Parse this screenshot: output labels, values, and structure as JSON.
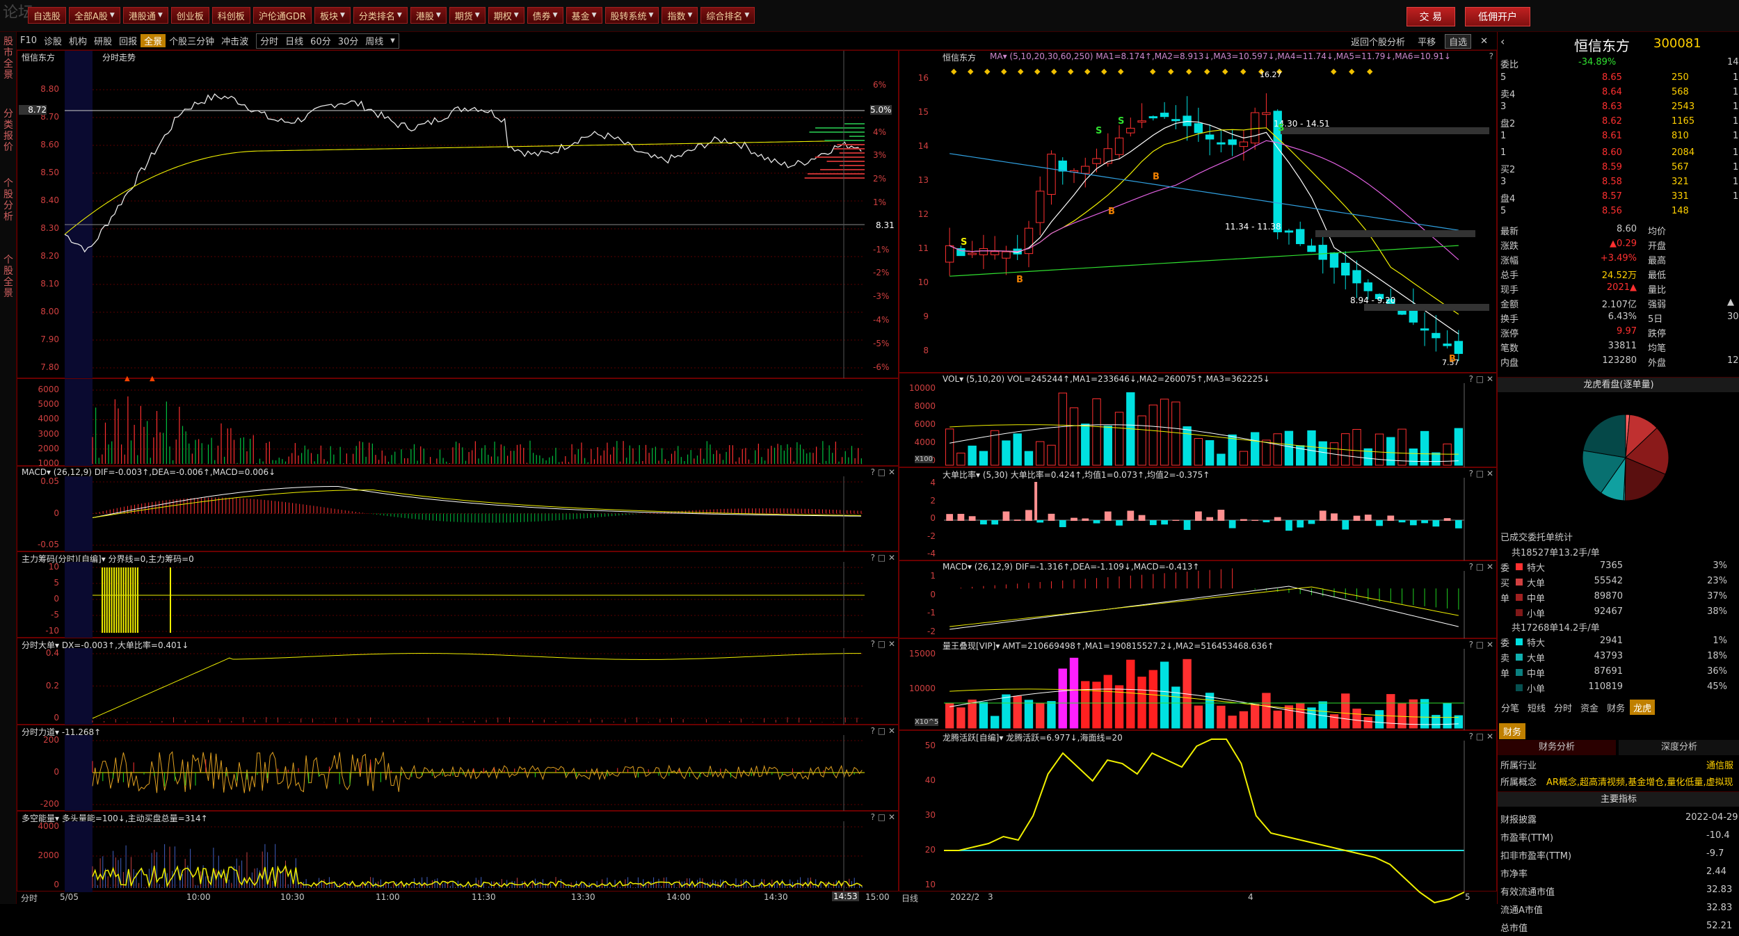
{
  "window": {
    "logo": "论坛",
    "title": "恒信东方"
  },
  "menu": [
    {
      "label": "自选股",
      "dd": false
    },
    {
      "label": "全部A股",
      "dd": true
    },
    {
      "label": "港股通",
      "dd": true
    },
    {
      "label": "创业板",
      "dd": false
    },
    {
      "label": "科创板",
      "dd": false
    },
    {
      "label": "沪伦通GDR",
      "dd": false
    },
    {
      "label": "板块",
      "dd": true
    },
    {
      "label": "分类排名",
      "dd": true
    },
    {
      "label": "港股",
      "dd": true
    },
    {
      "label": "期货",
      "dd": true
    },
    {
      "label": "期权",
      "dd": true
    },
    {
      "label": "债券",
      "dd": true
    },
    {
      "label": "基金",
      "dd": true
    },
    {
      "label": "股转系统",
      "dd": true
    },
    {
      "label": "指数",
      "dd": true
    },
    {
      "label": "综合排名",
      "dd": true
    }
  ],
  "trade": {
    "trade_label": "交 易",
    "open_account_label": "低佣开户"
  },
  "leftstrip": [
    {
      "label": "股市全景"
    },
    {
      "label": "分类报价"
    },
    {
      "label": "个股分析"
    },
    {
      "label": "个股全景"
    }
  ],
  "toolbar": {
    "left": [
      "F10",
      "诊股",
      "机构",
      "研股",
      "回报",
      "全景",
      "个股三分钟",
      "冲击波"
    ],
    "active": "全景",
    "periods": [
      "分时",
      "日线",
      "60分",
      "30分",
      "周线"
    ],
    "back": "返回个股分析",
    "flat": "平移",
    "watch": "自选"
  },
  "intraday": {
    "title": "恒信东方",
    "subtitle": "分时走势",
    "prices": [
      "8.80",
      "8.70",
      "8.60",
      "8.50",
      "8.40",
      "8.30",
      "8.20",
      "8.10",
      "8.00",
      "7.90",
      "7.80"
    ],
    "pcts": [
      "6%",
      "5%",
      "4%",
      "3%",
      "2%",
      "1%",
      "",
      "-1%",
      "-2%",
      "-3%",
      "-4%",
      "-5%",
      "-6%"
    ],
    "price_flag": "8.72",
    "pct_flag": "5.0%",
    "prev_close": "8.31",
    "vol_ticks": [
      "6000",
      "5000",
      "4000",
      "3000",
      "2000",
      "1000"
    ],
    "times": [
      "5/05",
      "10:00",
      "10:30",
      "11:00",
      "11:30",
      "13:30",
      "14:00",
      "14:30",
      "15:00"
    ],
    "last_time": "14:53",
    "axis_label": "分时"
  },
  "sub_left": [
    {
      "name": "MACD",
      "title": "MACD▾ (26,12,9)  DIF=-0.003↑,DEA=-0.006↑,MACD=0.006↓",
      "ticks": [
        "0.05",
        "0",
        "-0.05"
      ]
    },
    {
      "name": "zhuli",
      "title": "主力筹码(分时)[自编]▾ 分界线=0,主力筹码=0",
      "ticks": [
        "10",
        "5",
        "0",
        "-5",
        "-10"
      ]
    },
    {
      "name": "dadan",
      "title": "分时大单▾ DX=-0.003↑,大单比率=0.401↓",
      "ticks": [
        "0.4",
        "0.2",
        "0"
      ]
    },
    {
      "name": "lidao",
      "title": "分时力道▾ -11.268↑",
      "ticks": [
        "200",
        "0",
        "-200"
      ]
    },
    {
      "name": "duokong",
      "title": "多空能量▾ 多头量能=100↓,主动买盘总量=314↑",
      "ticks": [
        "4000",
        "2000",
        "0"
      ]
    }
  ],
  "kline": {
    "title": "恒信东方",
    "ma": "MA▾ (5,10,20,30,60,250)  MA1=8.174↑,MA2=8.913↓,MA3=10.597↓,MA4=11.74↓,MA5=11.79↓,MA6=10.91↓",
    "prices": [
      "16",
      "15",
      "14",
      "13",
      "12",
      "11",
      "10",
      "9",
      "8"
    ],
    "annot": [
      "14.30 - 14.51",
      "11.34 - 11.38",
      "8.94 - 9.20"
    ],
    "hi": "16.27",
    "lo": "7.57",
    "dates": [
      "2022/2",
      "3",
      "4",
      "5"
    ],
    "axis_label": "日线"
  },
  "sub_right": [
    {
      "name": "vol",
      "title": "VOL▾ (5,10,20)  VOL=245244↑,MA1=233646↓,MA2=260075↑,MA3=362225↓",
      "ticks": [
        "10000",
        "8000",
        "6000",
        "4000",
        "2000"
      ],
      "unit": "X100"
    },
    {
      "name": "ddbl",
      "title": "大单比率▾ (5,30)  大单比率=0.424↑,均值1=0.073↑,均值2=-0.375↑",
      "ticks": [
        "4",
        "2",
        "0",
        "-2",
        "-4"
      ]
    },
    {
      "name": "macd2",
      "title": "MACD▾ (26,12,9)  DIF=-1.316↑,DEA=-1.109↓,MACD=-0.413↑",
      "ticks": [
        "1",
        "0",
        "-1",
        "-2"
      ]
    },
    {
      "name": "lwdx",
      "title": "量王叠现[VIP]▾ AMT=210669498↑,MA1=190815527.2↓,MA2=516453468.636↑",
      "ticks": [
        "15000",
        "10000",
        "5000"
      ],
      "unit": "X10^5"
    },
    {
      "name": "lthy",
      "title": "龙腾活跃[自编]▾ 龙腾活跃=6.977↓,海面线=20",
      "ticks": [
        "50",
        "40",
        "30",
        "20",
        "10"
      ]
    }
  ],
  "quote": {
    "name": "恒信东方",
    "code": "300081",
    "webi": "委比",
    "webi_v": "-34.89%",
    "webi_r": "14",
    "sells": [
      {
        "l": "5",
        "p": "8.65",
        "v": "250",
        "x": "1"
      },
      {
        "l": "卖4",
        "p": "8.64",
        "v": "568",
        "x": "1"
      },
      {
        "l": "3",
        "p": "8.63",
        "v": "2543",
        "x": "1"
      },
      {
        "l": "盘2",
        "p": "8.62",
        "v": "1165",
        "x": "1"
      },
      {
        "l": "1",
        "p": "8.61",
        "v": "810",
        "x": "1"
      }
    ],
    "buys": [
      {
        "l": "1",
        "p": "8.60",
        "v": "2084",
        "x": "1"
      },
      {
        "l": "买2",
        "p": "8.59",
        "v": "567",
        "x": "1"
      },
      {
        "l": "3",
        "p": "8.58",
        "v": "321",
        "x": "1"
      },
      {
        "l": "盘4",
        "p": "8.57",
        "v": "331",
        "x": "1"
      },
      {
        "l": "5",
        "p": "8.56",
        "v": "148",
        "x": ""
      }
    ],
    "stats": [
      [
        "最新",
        "8.60",
        "均价",
        ""
      ],
      [
        "涨跌",
        "▲0.29",
        "开盘",
        ""
      ],
      [
        "涨幅",
        "+3.49%",
        "最高",
        ""
      ],
      [
        "总手",
        "24.52万",
        "最低",
        ""
      ],
      [
        "现手",
        "2021▲",
        "量比",
        ""
      ],
      [
        "金额",
        "2.107亿",
        "强弱",
        "▲"
      ],
      [
        "换手",
        "6.43%",
        "5日",
        "30."
      ],
      [
        "涨停",
        "9.97",
        "跌停",
        ""
      ],
      [
        "笔数",
        "33811",
        "均笔",
        ""
      ],
      [
        "内盘",
        "123280",
        "外盘",
        "12"
      ]
    ],
    "pie_title": "龙虎看盘(逐单量)",
    "entrust": "已成交委托单统计",
    "buy_total": "共18527单13.2手/单",
    "buy_rows": [
      [
        "特大",
        "7365",
        "3%"
      ],
      [
        "大单",
        "55542",
        "23%"
      ],
      [
        "中单",
        "89870",
        "37%"
      ],
      [
        "小单",
        "92467",
        "38%"
      ]
    ],
    "sell_total": "共17268单14.2手/单",
    "sell_rows": [
      [
        "特大",
        "2941",
        "1%"
      ],
      [
        "大单",
        "43793",
        "18%"
      ],
      [
        "中单",
        "87691",
        "36%"
      ],
      [
        "小单",
        "110819",
        "45%"
      ]
    ],
    "buy_side": [
      "委",
      "买",
      "单"
    ],
    "sell_side": [
      "委",
      "卖",
      "单"
    ],
    "tabs": [
      "分笔",
      "短线",
      "分时",
      "资金",
      "财务",
      "龙虎"
    ],
    "caiwu": "财务",
    "fin_tab1": "财务分析",
    "fin_tab2": "深度分析",
    "industry_l": "所属行业",
    "industry": "通信服",
    "concept_l": "所属概念",
    "concept": "AR概念,超高清视频,基金增仓,量化低量,虚拟现",
    "main_idx": "主要指标",
    "fin": [
      [
        "财报披露",
        "2022-04-29"
      ],
      [
        "市盈率(TTM)",
        "-10.4"
      ],
      [
        "扣非市盈率(TTM)",
        "-9.7"
      ],
      [
        "市净率",
        "2.44"
      ],
      [
        "有效流通市值",
        "32.83"
      ],
      [
        "流通A市值",
        "32.83"
      ],
      [
        "总市值",
        "52.21"
      ]
    ]
  },
  "colors": {
    "up": "#ff3030",
    "down": "#00e0e0",
    "grid": "#5a0000",
    "yellow": "#f0f000",
    "white": "#e8e8e8"
  }
}
